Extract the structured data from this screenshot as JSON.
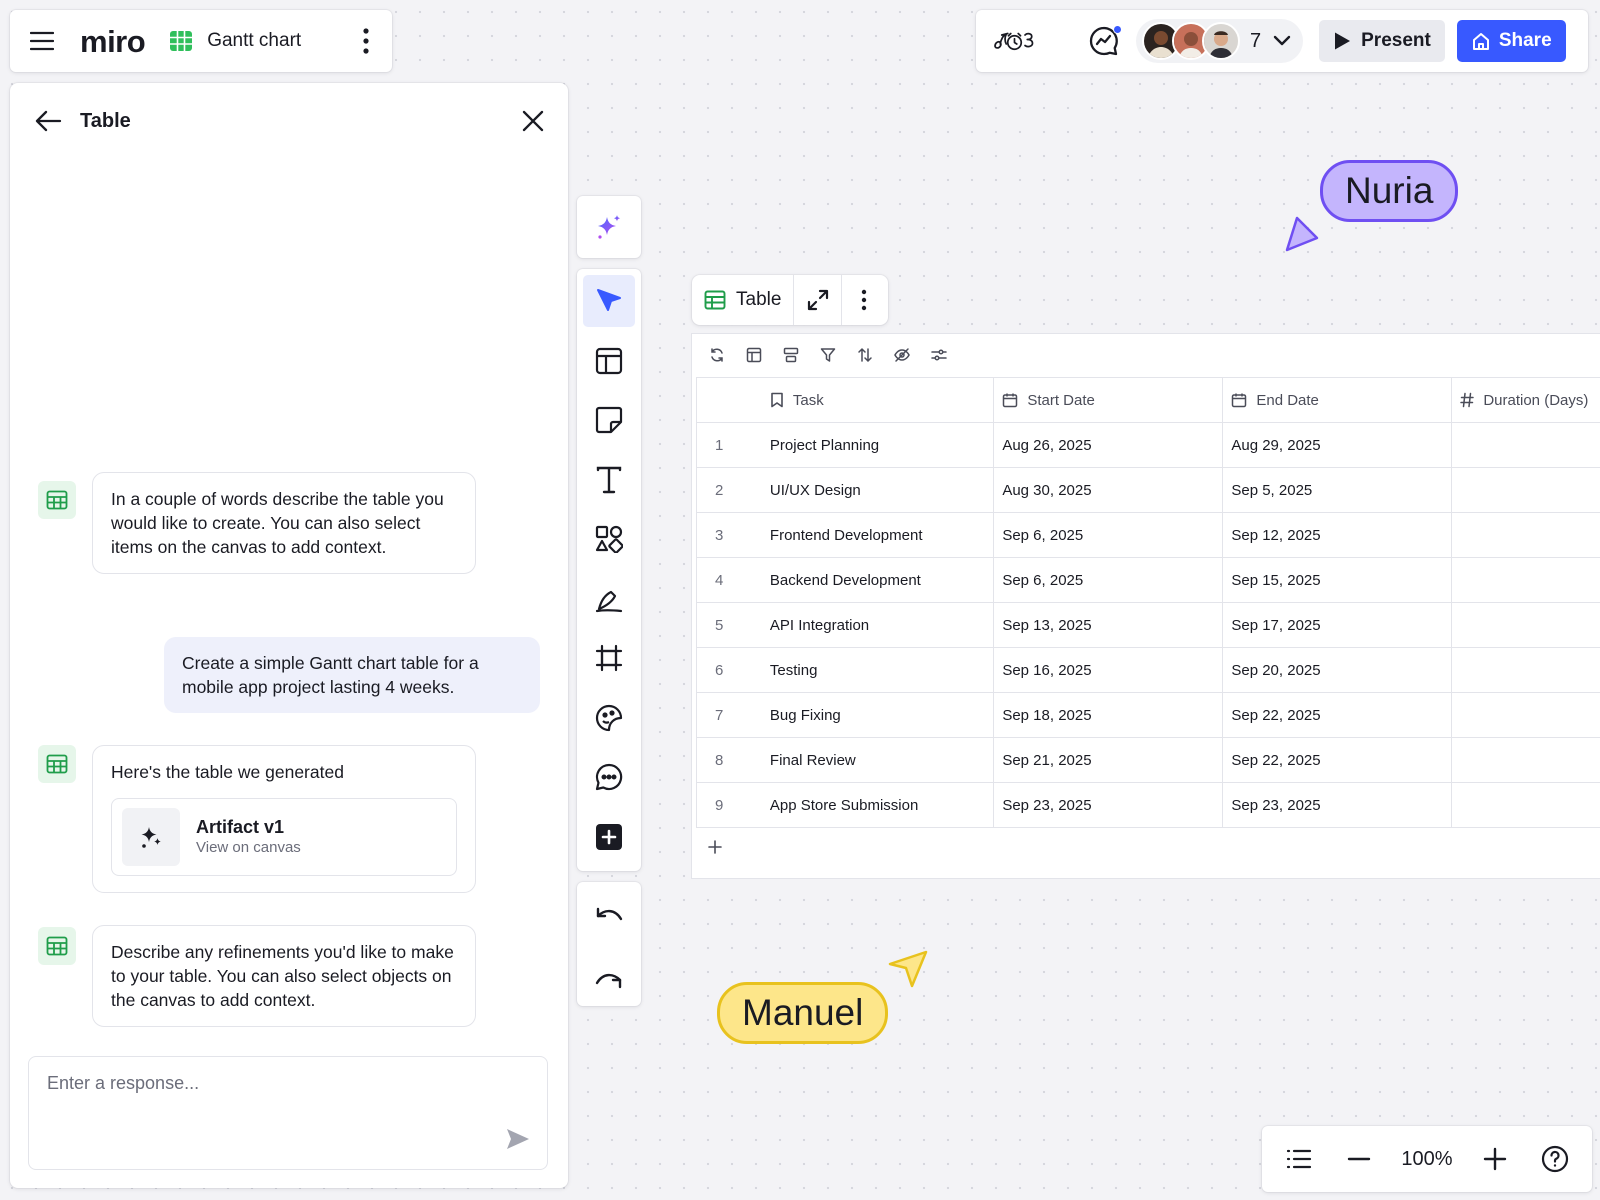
{
  "header": {
    "logo": "miro",
    "board_name": "Gantt chart",
    "collaborator_count": "7",
    "present_label": "Present",
    "share_label": "Share",
    "accent_color": "#3859ff"
  },
  "panel": {
    "title": "Table",
    "messages": [
      {
        "from": "assistant",
        "text": "In a couple of words describe the table you would like to create. You can also select items on the canvas to add context."
      },
      {
        "from": "user",
        "text": "Create a simple Gantt chart table for a mobile app project lasting 4 weeks."
      },
      {
        "from": "assistant",
        "text": "Here's the table we generated"
      },
      {
        "from": "assistant",
        "text": "Describe any refinements you'd like to make to your table. You can also select objects on the canvas to add context."
      }
    ],
    "artifact": {
      "title": "Artifact v1",
      "subtitle": "View on canvas"
    },
    "reply_placeholder": "Enter a response..."
  },
  "toolbar": {
    "tools": [
      "ai-sparkle",
      "select",
      "templates",
      "sticky-note",
      "text",
      "shapes",
      "pen",
      "frame",
      "stickers",
      "comment",
      "more-apps"
    ],
    "history": [
      "undo",
      "redo"
    ]
  },
  "table": {
    "label": "Table",
    "columns": [
      {
        "name": "Task",
        "icon": "bookmark-icon"
      },
      {
        "name": "Start Date",
        "icon": "calendar-icon"
      },
      {
        "name": "End Date",
        "icon": "calendar-icon"
      },
      {
        "name": "Duration (Days)",
        "icon": "hash-icon"
      }
    ],
    "rows": [
      {
        "num": "1",
        "task": "Project Planning",
        "start": "Aug 26, 2025",
        "end": "Aug 29, 2025",
        "duration": ""
      },
      {
        "num": "2",
        "task": "UI/UX Design",
        "start": "Aug 30, 2025",
        "end": "Sep 5, 2025",
        "duration": ""
      },
      {
        "num": "3",
        "task": "Frontend Development",
        "start": "Sep 6, 2025",
        "end": "Sep 12, 2025",
        "duration": ""
      },
      {
        "num": "4",
        "task": "Backend Development",
        "start": "Sep 6, 2025",
        "end": "Sep 15, 2025",
        "duration": ""
      },
      {
        "num": "5",
        "task": "API Integration",
        "start": "Sep 13, 2025",
        "end": "Sep 17, 2025",
        "duration": ""
      },
      {
        "num": "6",
        "task": "Testing",
        "start": "Sep 16, 2025",
        "end": "Sep 20, 2025",
        "duration": ""
      },
      {
        "num": "7",
        "task": "Bug Fixing",
        "start": "Sep 18, 2025",
        "end": "Sep 22, 2025",
        "duration": ""
      },
      {
        "num": "8",
        "task": "Final Review",
        "start": "Sep 21, 2025",
        "end": "Sep 22, 2025",
        "duration": ""
      },
      {
        "num": "9",
        "task": "App Store Submission",
        "start": "Sep 23, 2025",
        "end": "Sep 23, 2025",
        "duration": ""
      }
    ]
  },
  "cursors": [
    {
      "name": "Nuria",
      "color": "#c4b5fd",
      "border": "#6f4ff2"
    },
    {
      "name": "Manuel",
      "color": "#fde68a",
      "border": "#e8c21e"
    }
  ],
  "zoom": {
    "level": "100%"
  }
}
